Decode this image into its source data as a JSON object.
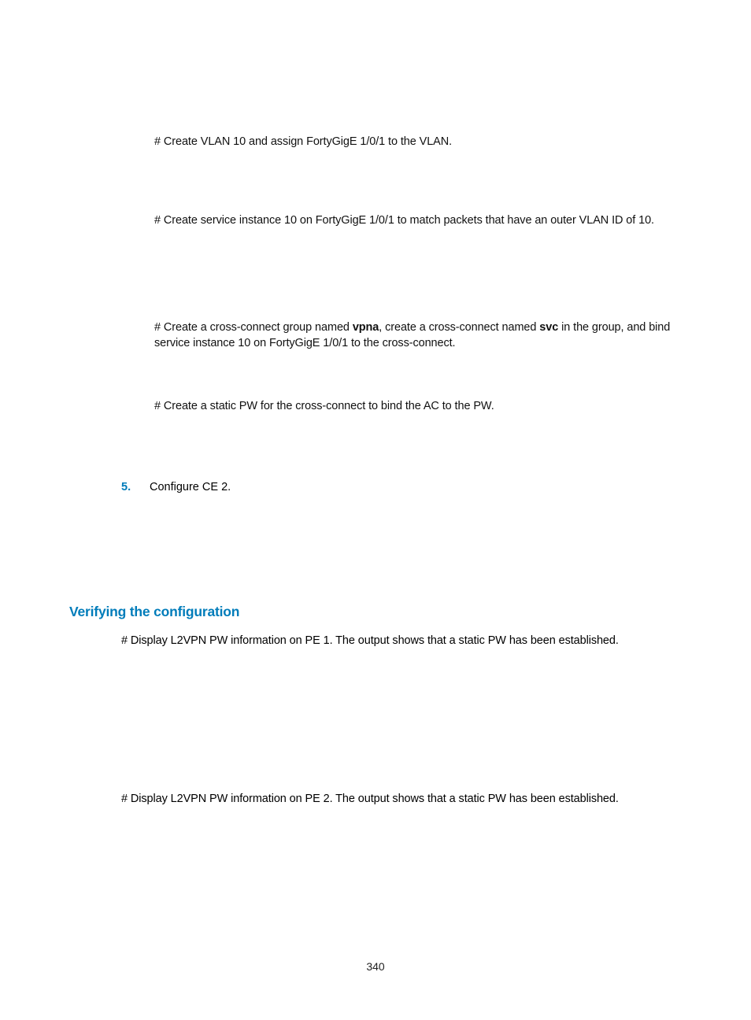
{
  "step1": "# Create VLAN 10 and assign FortyGigE 1/0/1 to the VLAN.",
  "step2": "# Create service instance 10 on FortyGigE 1/0/1 to match packets that have an outer VLAN ID of 10.",
  "step3_pre": "# Create a cross-connect group named ",
  "step3_b1": "vpna",
  "step3_mid": ", create a cross-connect named ",
  "step3_b2": "svc",
  "step3_post": " in the group, and bind service instance 10 on FortyGigE 1/0/1 to the cross-connect.",
  "step4": "# Create a static PW for the cross-connect to bind the AC to the PW.",
  "num5": "5.",
  "num5_text": "Configure CE 2.",
  "heading": "Verifying the configuration",
  "body1": "# Display L2VPN PW information on PE 1. The output shows that a static PW has been established.",
  "body2": "# Display L2VPN PW information on PE 2. The output shows that a static PW has been established.",
  "pagenum": "340"
}
